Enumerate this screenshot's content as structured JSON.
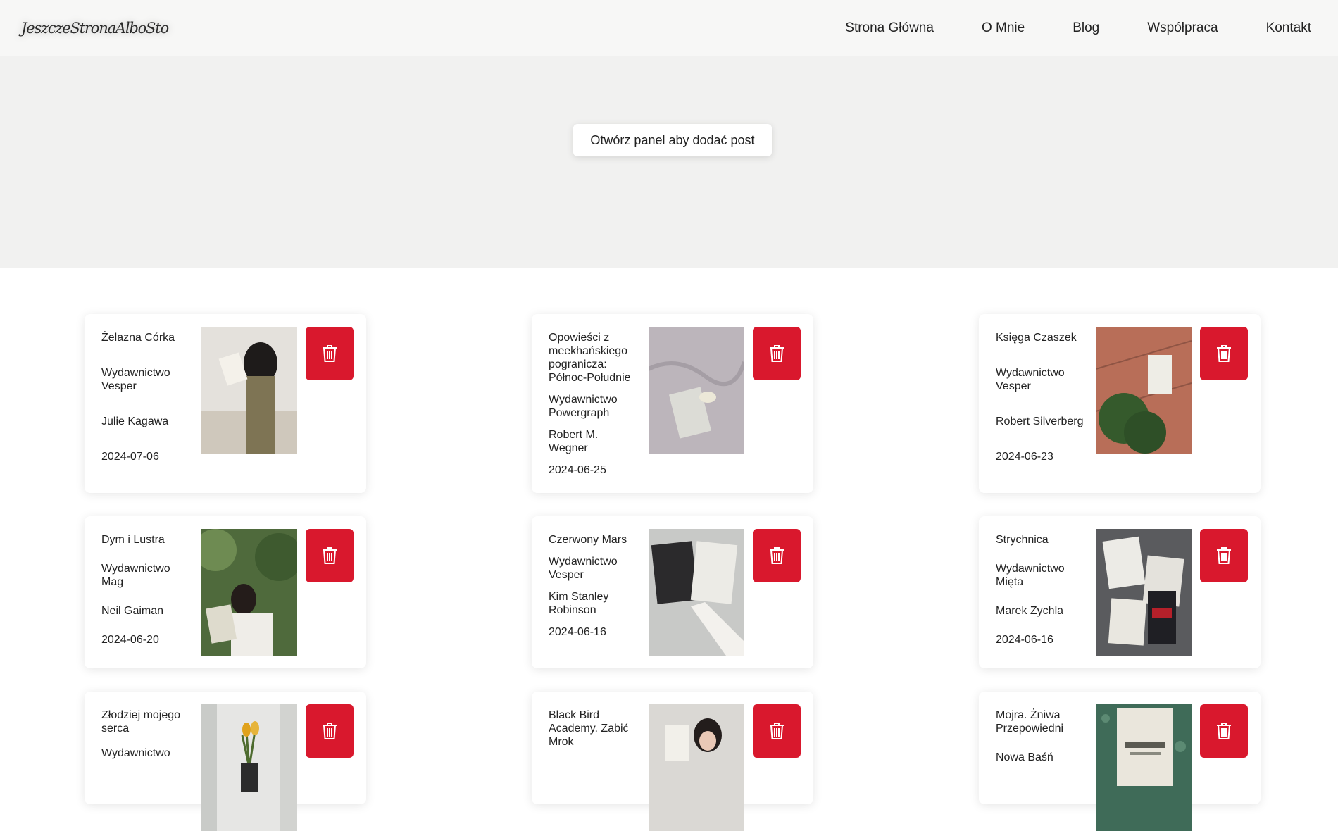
{
  "site": {
    "logo": "JeszczeStronaAlboSto"
  },
  "nav": [
    "Strona Główna",
    "O Mnie",
    "Blog",
    "Współpraca",
    "Kontakt"
  ],
  "hero": {
    "button_label": "Otwórz panel aby dodać post"
  },
  "posts": [
    {
      "title": "Żelazna Córka",
      "publisher": "Wydawnictwo Vesper",
      "author": "Julie Kagawa",
      "date": "2024-07-06"
    },
    {
      "title": "Opowieści z meekhańskiego pogranicza: Północ-Południe",
      "publisher": "Wydawnictwo Powergraph",
      "author": "Robert M. Wegner",
      "date": "2024-06-25"
    },
    {
      "title": "Księga Czaszek",
      "publisher": "Wydawnictwo Vesper",
      "author": "Robert Silverberg",
      "date": "2024-06-23"
    },
    {
      "title": "Dym i Lustra",
      "publisher": "Wydawnictwo Mag",
      "author": "Neil Gaiman",
      "date": "2024-06-20"
    },
    {
      "title": "Czerwony Mars",
      "publisher": "Wydawnictwo Vesper",
      "author": "Kim Stanley Robinson",
      "date": "2024-06-16"
    },
    {
      "title": "Strychnica",
      "publisher": "Wydawnictwo Mięta",
      "author": "Marek Zychla",
      "date": "2024-06-16"
    },
    {
      "title": "Złodziej mojego serca",
      "publisher": "Wydawnictwo",
      "author": "",
      "date": ""
    },
    {
      "title": "Black Bird Academy. Zabić Mrok",
      "publisher": "",
      "author": "",
      "date": ""
    },
    {
      "title": "Mojra. Żniwa Przepowiedni",
      "publisher": "Nowa Baśń",
      "author": "",
      "date": ""
    }
  ],
  "colors": {
    "delete": "#d9182d",
    "hero_bg": "#f1f1f0",
    "nav_bg": "#f7f7f6"
  },
  "icons": {
    "delete": "trash-icon"
  }
}
